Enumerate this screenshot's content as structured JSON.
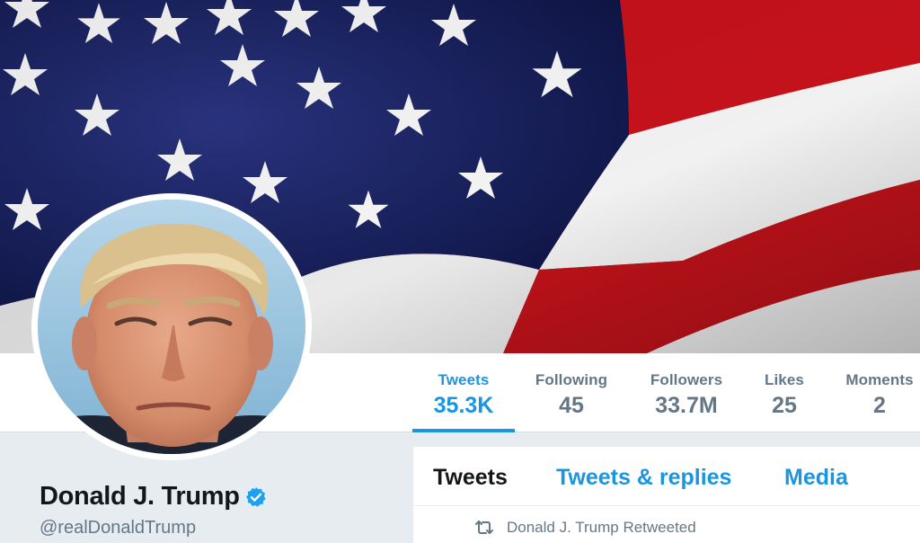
{
  "banner": {
    "icon": "us-flag-banner"
  },
  "profile": {
    "name": "Donald J. Trump",
    "handle": "@realDonaldTrump",
    "verified": true,
    "accent_color": "#1b95e0"
  },
  "stats": [
    {
      "label": "Tweets",
      "value": "35.3K",
      "active": true
    },
    {
      "label": "Following",
      "value": "45",
      "active": false
    },
    {
      "label": "Followers",
      "value": "33.7M",
      "active": false
    },
    {
      "label": "Likes",
      "value": "25",
      "active": false
    },
    {
      "label": "Moments",
      "value": "2",
      "active": false
    }
  ],
  "timeline": {
    "tabs": [
      {
        "label": "Tweets",
        "active": true
      },
      {
        "label": "Tweets & replies",
        "active": false
      },
      {
        "label": "Media",
        "active": false
      }
    ],
    "retweet_context": "Donald J. Trump Retweeted"
  }
}
